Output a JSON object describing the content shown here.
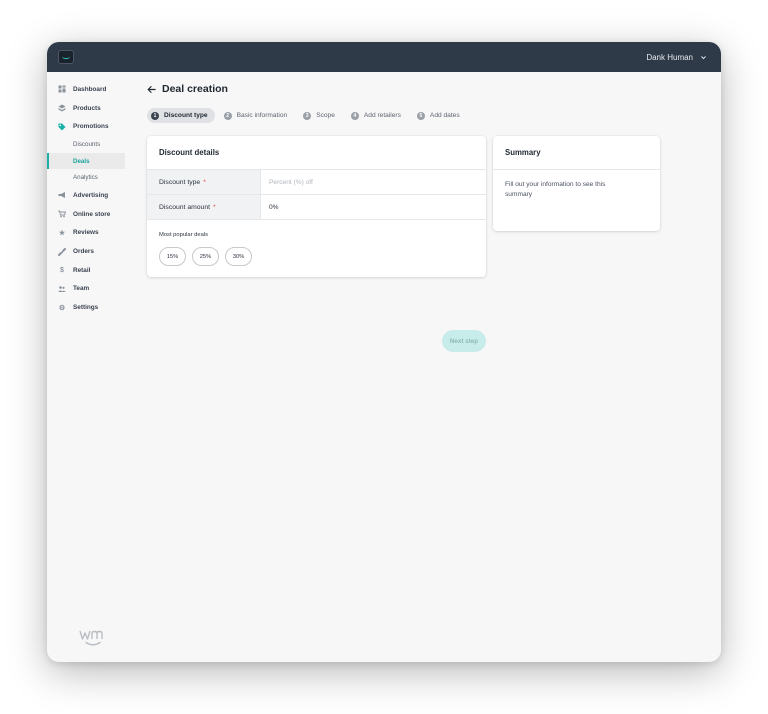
{
  "topbar": {
    "user_name": "Dank Human"
  },
  "sidebar": {
    "items": [
      {
        "label": "Dashboard",
        "icon": "dashboard-icon"
      },
      {
        "label": "Products",
        "icon": "products-icon"
      },
      {
        "label": "Promotions",
        "icon": "tag-icon"
      },
      {
        "label": "Advertising",
        "icon": "megaphone-icon"
      },
      {
        "label": "Online store",
        "icon": "cart-icon"
      },
      {
        "label": "Reviews",
        "icon": "star-icon"
      },
      {
        "label": "Orders",
        "icon": "orders-icon"
      },
      {
        "label": "Retail",
        "icon": "dollar-icon"
      },
      {
        "label": "Team",
        "icon": "team-icon"
      },
      {
        "label": "Settings",
        "icon": "gear-icon"
      }
    ],
    "promotions_sub": [
      "Discounts",
      "Deals",
      "Analytics"
    ],
    "selected_sub": "Deals"
  },
  "page": {
    "title": "Deal creation"
  },
  "steps": [
    {
      "num": "1",
      "label": "Discount type"
    },
    {
      "num": "2",
      "label": "Basic information"
    },
    {
      "num": "3",
      "label": "Scope"
    },
    {
      "num": "4",
      "label": "Add retailers"
    },
    {
      "num": "5",
      "label": "Add dates"
    }
  ],
  "details": {
    "title": "Discount details",
    "discount_type_label": "Discount type",
    "discount_type_placeholder": "Percent (%) off",
    "discount_amount_label": "Discount amount",
    "discount_amount_value": "0%",
    "required_mark": "*",
    "popular_label": "Most popular deals",
    "chips": [
      "15%",
      "25%",
      "30%"
    ]
  },
  "next_button": "Next step",
  "summary": {
    "title": "Summary",
    "text": "Fill out your information to see this summary"
  },
  "colors": {
    "topbar": "#2f3a48",
    "accent": "#1ab0a7",
    "required": "#e0463d",
    "next_button_bg": "#c7ecea"
  }
}
